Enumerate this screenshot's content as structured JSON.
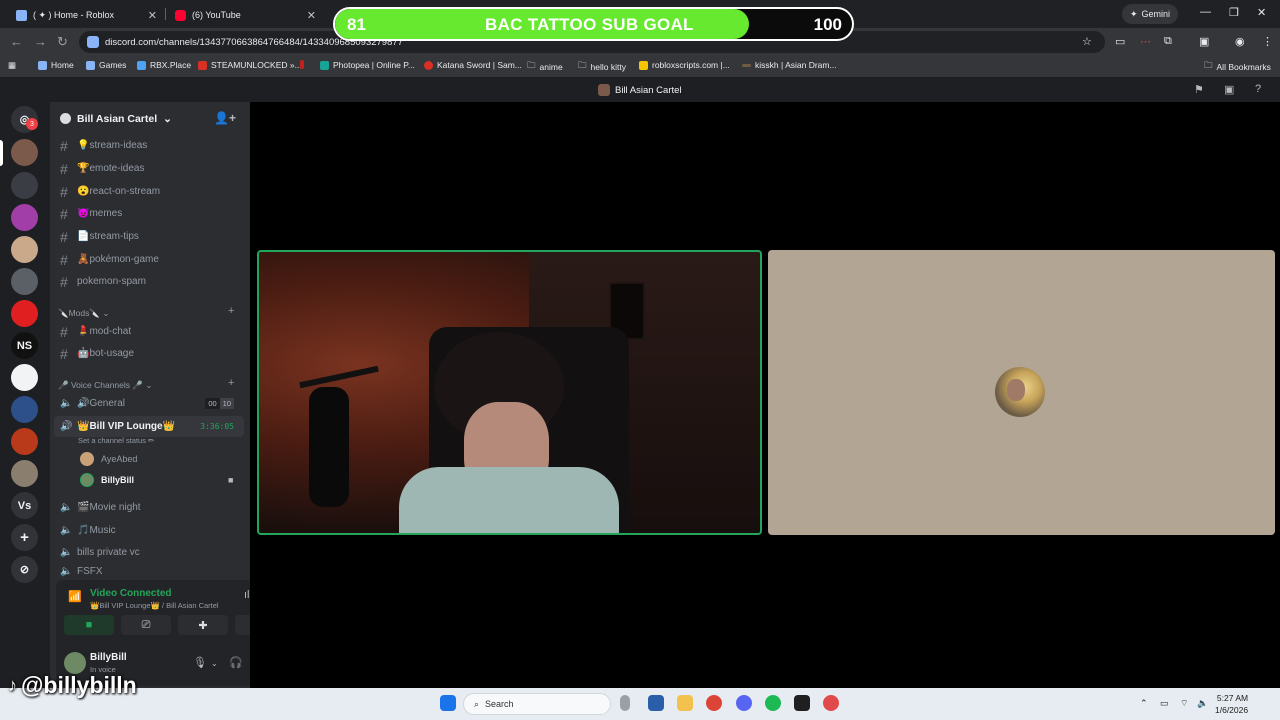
{
  "browser": {
    "tabs": [
      {
        "title": "( ✦ ) Home - Roblox",
        "close": "✕"
      },
      {
        "title": "(6) YouTube",
        "close": "✕"
      }
    ],
    "gemini_label": "Gemini",
    "url": "discord.com/channels/1343770663864766484/1433409685093279877",
    "bookmarks": [
      "Home",
      "Games",
      "RBX.Place",
      "STEAMUNLOCKED »...",
      "Photopea | Online P...",
      "Katana Sword | Sam...",
      "anime",
      "hello kitty",
      "robloxscripts.com |...",
      "kisskh | Asian Dram..."
    ],
    "all_bookmarks": "All Bookmarks"
  },
  "goal": {
    "start": "81",
    "title": "BAC TATTOO SUB GOAL",
    "end": "100",
    "progress_fraction": 0.8
  },
  "discord": {
    "header_title": "Bill Asian Cartel",
    "server_name": "Bill Asian Cartel",
    "rail_badge": "3",
    "rail_ns": "NS",
    "rail_vs": "Vs",
    "text_channels": [
      {
        "name": "💡stream-ideas"
      },
      {
        "name": "🏆emote-ideas"
      },
      {
        "name": "😮react-on-stream"
      },
      {
        "name": "😈memes"
      },
      {
        "name": "📄stream-tips"
      },
      {
        "name": "🧸pokémon-game"
      },
      {
        "name": "pokemon-spam"
      }
    ],
    "mods_category": "🔪Mods🔪",
    "mod_channels": [
      {
        "name": "💄mod-chat"
      },
      {
        "name": "🤖bot-usage"
      }
    ],
    "voice_category": "🎤 Voice Channels 🎤",
    "voice_channels": {
      "general": {
        "name": "🔊General",
        "count_a": "00",
        "count_b": "10"
      },
      "vip": {
        "name": "👑Bill VIP Lounge👑",
        "timer": "3:36:05",
        "status_hint": "Set a channel status ✏"
      },
      "vip_users": [
        "AyeAbed",
        "BillyBill"
      ],
      "others": [
        "🎬Movie night",
        "🎵Music",
        "bills private vc",
        "FSFX"
      ]
    },
    "voice_panel": {
      "status": "Video Connected",
      "location": "👑Bill VIP Lounge👑 / Bill Asian Cartel"
    },
    "user": {
      "name": "BillyBill",
      "status": "In voice"
    }
  },
  "overlay_handle": "@billybilln",
  "taskbar": {
    "search_placeholder": "Search",
    "time": "5:27 AM",
    "date": "1/6/2026"
  },
  "colors": {
    "accent_green": "#23a55a",
    "goal_green": "#67e92f",
    "discord_bg": "#2b2d31"
  }
}
